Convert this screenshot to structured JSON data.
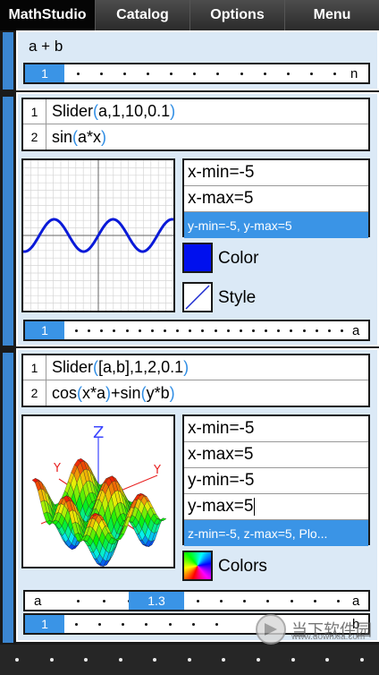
{
  "menu": {
    "tabs": [
      {
        "label": "MathStudio",
        "active": true
      },
      {
        "label": "Catalog",
        "active": false
      },
      {
        "label": "Options",
        "active": false
      },
      {
        "label": "Menu",
        "active": false
      }
    ]
  },
  "section1": {
    "expression": "a + b",
    "slider": {
      "knob_label": "1",
      "end_label": "n"
    }
  },
  "section2": {
    "lines": [
      {
        "num": "1",
        "parts": [
          [
            "t",
            "Slider"
          ],
          [
            "p",
            "("
          ],
          [
            "t",
            "a,1,10,0.1"
          ],
          [
            "p",
            ")"
          ]
        ]
      },
      {
        "num": "2",
        "parts": [
          [
            "t",
            "sin"
          ],
          [
            "p",
            "("
          ],
          [
            "t",
            "a*x"
          ],
          [
            "p",
            ")"
          ]
        ]
      }
    ],
    "ranges": [
      "x-min=-5",
      "x-max=5"
    ],
    "range_selected": "y-min=-5, y-max=5",
    "color_label": "Color",
    "style_label": "Style",
    "colors": {
      "swatch": "#0010ee",
      "curve": "#0a1ad8"
    },
    "slider": {
      "knob_label": "1",
      "end_label": "a"
    }
  },
  "section3": {
    "lines": [
      {
        "num": "1",
        "parts": [
          [
            "t",
            "Slider"
          ],
          [
            "p",
            "("
          ],
          [
            "t",
            "[a,b],1,2,0.1"
          ],
          [
            "p",
            ")"
          ]
        ]
      },
      {
        "num": "2",
        "parts": [
          [
            "t",
            "cos"
          ],
          [
            "p",
            "("
          ],
          [
            "t",
            "x*a"
          ],
          [
            "p",
            ")"
          ],
          [
            "t",
            "+sin"
          ],
          [
            "p",
            "("
          ],
          [
            "t",
            "y*b"
          ],
          [
            "p",
            ")"
          ]
        ]
      }
    ],
    "ranges": [
      "x-min=-5",
      "x-max=5",
      "y-min=-5",
      "y-max=5"
    ],
    "range_selected": "z-min=-5, z-max=5, Plo...",
    "colors_label": "Colors",
    "axis_labels": {
      "z": "Z",
      "y": "Y"
    },
    "slider_a": {
      "start_label": "a",
      "knob_label": "1.3",
      "end_label": "a"
    },
    "slider_b": {
      "knob_label": "1",
      "end_label": "b"
    }
  },
  "watermark": {
    "text": "当下软件园",
    "url": "www.downxia.com"
  }
}
